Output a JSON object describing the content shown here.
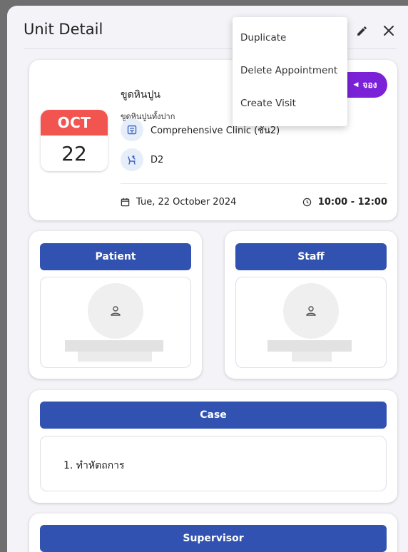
{
  "dialog": {
    "title": "Unit Detail"
  },
  "unit": {
    "calendar": {
      "month": "OCT",
      "day": "22"
    },
    "name": "ขูดหินปูน",
    "subtitle": "ขูดหินปูนทั้งปาก",
    "clinic": "Comprehensive Clinic (ชั้น2)",
    "chair": "D2",
    "badge": "จอง",
    "date": "Tue, 22 October 2024",
    "time": "10:00 - 12:00"
  },
  "patient": {
    "label": "Patient"
  },
  "staff": {
    "label": "Staff"
  },
  "case": {
    "label": "Case",
    "items": [
      "1. ทำหัตถการ"
    ]
  },
  "supervisor": {
    "label": "Supervisor"
  },
  "menu": {
    "items": [
      {
        "label": "Duplicate"
      },
      {
        "label": "Delete Appointment"
      },
      {
        "label": "Create Visit"
      }
    ]
  },
  "colors": {
    "primary": "#3152b0",
    "badge": "#7b22d9",
    "calendar_month": "#f2554f"
  }
}
